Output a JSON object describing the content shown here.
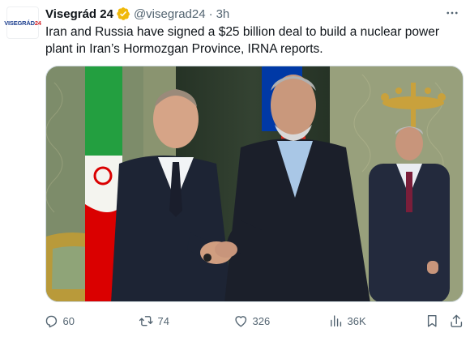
{
  "tweet": {
    "avatar_text_main": "VISEGRÁD",
    "avatar_text_accent": "24",
    "display_name": "Visegrád 24",
    "handle": "@visegrad24",
    "separator": "·",
    "time": "3h",
    "text": "Iran and Russia have signed a $25 billion deal to build a nuclear power plant in Iran’s Hormozgan Province, IRNA reports.",
    "verified_badge_color": "#f0b90b"
  },
  "actions": {
    "reply_count": "60",
    "retweet_count": "74",
    "like_count": "326",
    "views_count": "36K"
  },
  "icons": {
    "verified": "verified-badge-icon",
    "more": "more-dots-icon",
    "reply": "reply-icon",
    "retweet": "retweet-icon",
    "like": "heart-icon",
    "views": "views-chart-icon",
    "bookmark": "bookmark-icon",
    "share": "share-icon"
  },
  "colors": {
    "text": "#0f1419",
    "secondary": "#536471",
    "border": "#cfd9de"
  }
}
